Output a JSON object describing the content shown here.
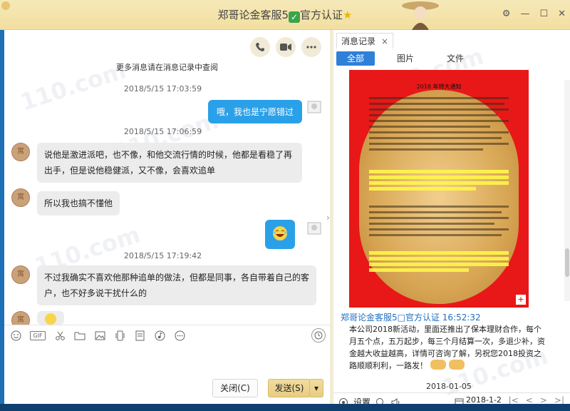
{
  "window": {
    "title_prefix": "郑哥论金客服5",
    "title_suffix": "官方认证",
    "check_glyph": "✓",
    "star_glyph": "★",
    "controls": [
      "⚙",
      "—",
      "☐",
      "✕"
    ]
  },
  "chat": {
    "hint": "更多消息请在消息记录中查阅",
    "messages": [
      {
        "time": "2018/5/15 17:03:59",
        "side": "right",
        "text": "哦，我也是宁愿错过"
      },
      {
        "time": "2018/5/15 17:06:59",
        "side": "left",
        "text": "说他是激进派吧，也不像，和他交流行情的时候，他都是看稳了再出手，但是说他稳健派，又不像，会喜欢追单"
      },
      {
        "side": "left",
        "text": "所以我也搞不懂他"
      },
      {
        "side": "right",
        "text": "",
        "emoji": "laughing-face"
      },
      {
        "time": "2018/5/15 17:19:42",
        "side": "left",
        "text": "不过我确实不喜欢他那种追单的做法，但都是同事，各自带着自己的客户，也不好多说干扰什么的"
      },
      {
        "side": "left",
        "text": "",
        "emoji": "smiling-face"
      }
    ],
    "avatar_text": "寓"
  },
  "toolbar_icons": [
    "smile-icon",
    "gif-icon",
    "scissors-icon",
    "folder-icon",
    "image-icon",
    "shake-icon",
    "document-icon",
    "music-icon",
    "more-icon"
  ],
  "gif_label": "GIF",
  "buttons": {
    "close": "关闭(C)",
    "send": "发送(S)",
    "send_arrow": "▾"
  },
  "history": {
    "tab_label": "消息记录",
    "tab_close": "×",
    "subtabs": [
      "全部",
      "图片",
      "文件"
    ],
    "active_subtab": "全部",
    "poster_title": "2018 年特大通知",
    "sender": "郑哥论金客服5□官方认证 16:52:32",
    "text": "本公司2018新活动，里面还推出了保本理财合作，每个月五个点，五万起步，每三个月结算一次，多退少补，资金越大收益越高，详情可咨询了解，另祝您2018投资之路顺顺利利，一路发！",
    "date": "2018-01-05",
    "settings_label": "设置",
    "calendar_date": "2018-1-2",
    "pager": [
      "|<",
      "<",
      ">",
      ">|"
    ]
  },
  "colors": {
    "accent": "#2f80d8",
    "bubble_blue": "#2aa0e8",
    "title_bar": "#f2dfa0",
    "poster_red": "#e81818"
  },
  "watermark": "110.com"
}
